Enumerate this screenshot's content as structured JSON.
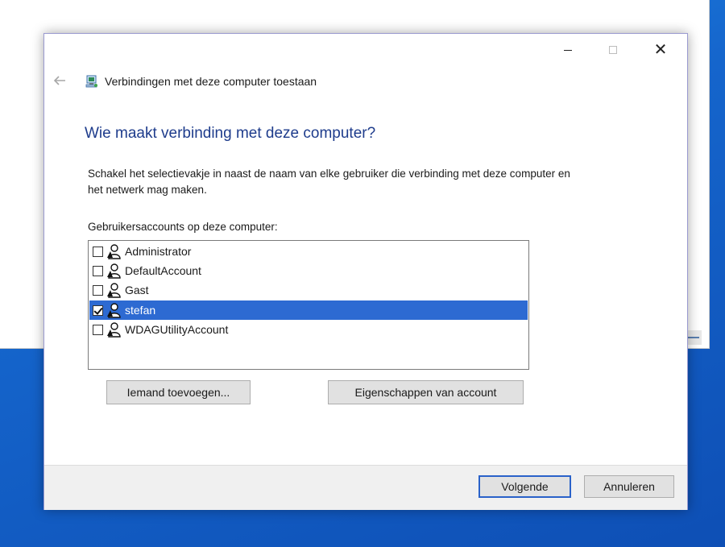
{
  "window": {
    "title": "Verbindingen met deze computer toestaan",
    "caption_minimize": "—",
    "caption_close": "✕"
  },
  "page": {
    "heading": "Wie maakt verbinding met deze computer?",
    "description": "Schakel het selectievakje in naast de naam van elke gebruiker die verbinding met deze computer en het netwerk mag maken.",
    "list_label": "Gebruikersaccounts op deze computer:"
  },
  "accounts": [
    {
      "name": "Administrator",
      "checked": false,
      "selected": false
    },
    {
      "name": "DefaultAccount",
      "checked": false,
      "selected": false
    },
    {
      "name": "Gast",
      "checked": false,
      "selected": false
    },
    {
      "name": "stefan",
      "checked": true,
      "selected": true
    },
    {
      "name": "WDAGUtilityAccount",
      "checked": false,
      "selected": false
    }
  ],
  "buttons": {
    "add": "Iemand toevoegen...",
    "properties": "Eigenschappen van account",
    "next": "Volgende",
    "cancel": "Annuleren"
  },
  "icons": {
    "back": "back-arrow-icon",
    "title": "network-computer-icon",
    "user": "user-account-icon"
  },
  "colors": {
    "heading": "#1e3c8c",
    "selection": "#2d6ad2",
    "default_button_border": "#2a62c9"
  }
}
